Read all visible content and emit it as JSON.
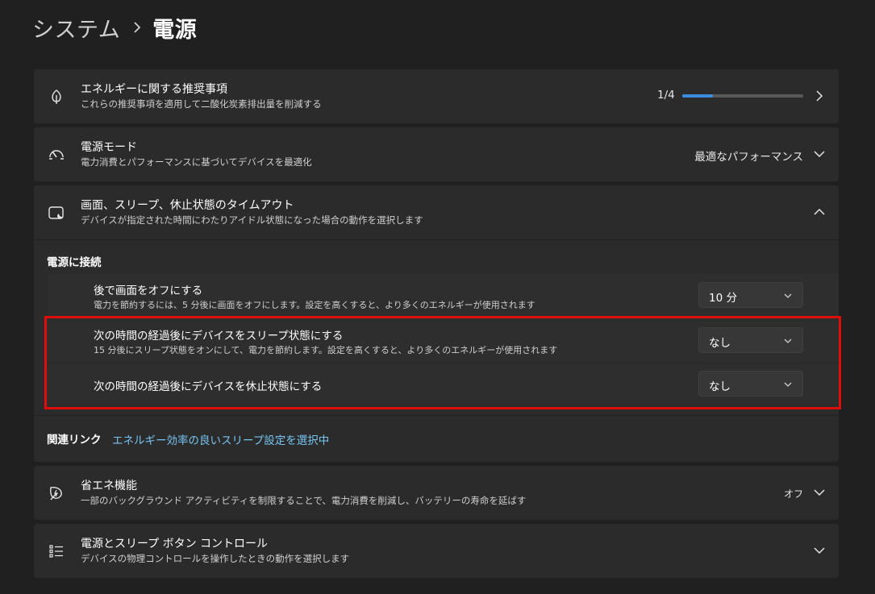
{
  "breadcrumb": {
    "parent": "システム",
    "separator": "›",
    "current": "電源"
  },
  "energy": {
    "title": "エネルギーに関する推奨事項",
    "subtitle": "これらの推奨事項を適用して二酸化炭素排出量を削減する",
    "progress_text": "1/4",
    "progress_fraction": 0.25,
    "icon": "leaf-icon"
  },
  "power_mode": {
    "title": "電源モード",
    "subtitle": "電力消費とパフォーマンスに基づいてデバイスを最適化",
    "value": "最適なパフォーマンス",
    "icon": "gauge-icon"
  },
  "timeouts": {
    "title": "画面、スリープ、休止状態のタイムアウト",
    "subtitle": "デバイスが指定された時間にわたりアイドル状態になった場合の動作を選択します",
    "icon": "screen-sleep-icon",
    "section_label": "電源に接続",
    "rows": [
      {
        "title": "後で画面をオフにする",
        "subtitle": "電力を節約するには、5 分後に画面をオフにします。設定を高くすると、より多くのエネルギーが使用されます",
        "value": "10 分"
      },
      {
        "title": "次の時間の経過後にデバイスをスリープ状態にする",
        "subtitle": "15 分後にスリープ状態をオンにして、電力を節約します。設定を高くすると、より多くのエネルギーが使用されます",
        "value": "なし"
      },
      {
        "title": "次の時間の経過後にデバイスを休止状態にする",
        "subtitle": "",
        "value": "なし"
      }
    ],
    "related_label": "関連リンク",
    "related_link": "エネルギー効率の良いスリープ設定を選択中"
  },
  "energy_saver": {
    "title": "省エネ機能",
    "subtitle": "一部のバックグラウンド アクティビティを制限することで、電力消費を削減し、バッテリーの寿命を延ばす",
    "value": "オフ",
    "icon": "energy-saver-icon"
  },
  "buttons": {
    "title": "電源とスリープ ボタン コントロール",
    "subtitle": "デバイスの物理コントロールを操作したときの動作を選択します",
    "icon": "list-icon"
  },
  "colors": {
    "accent": "#3b8de0",
    "link": "#77c4f0",
    "highlight": "#e00d0d"
  }
}
